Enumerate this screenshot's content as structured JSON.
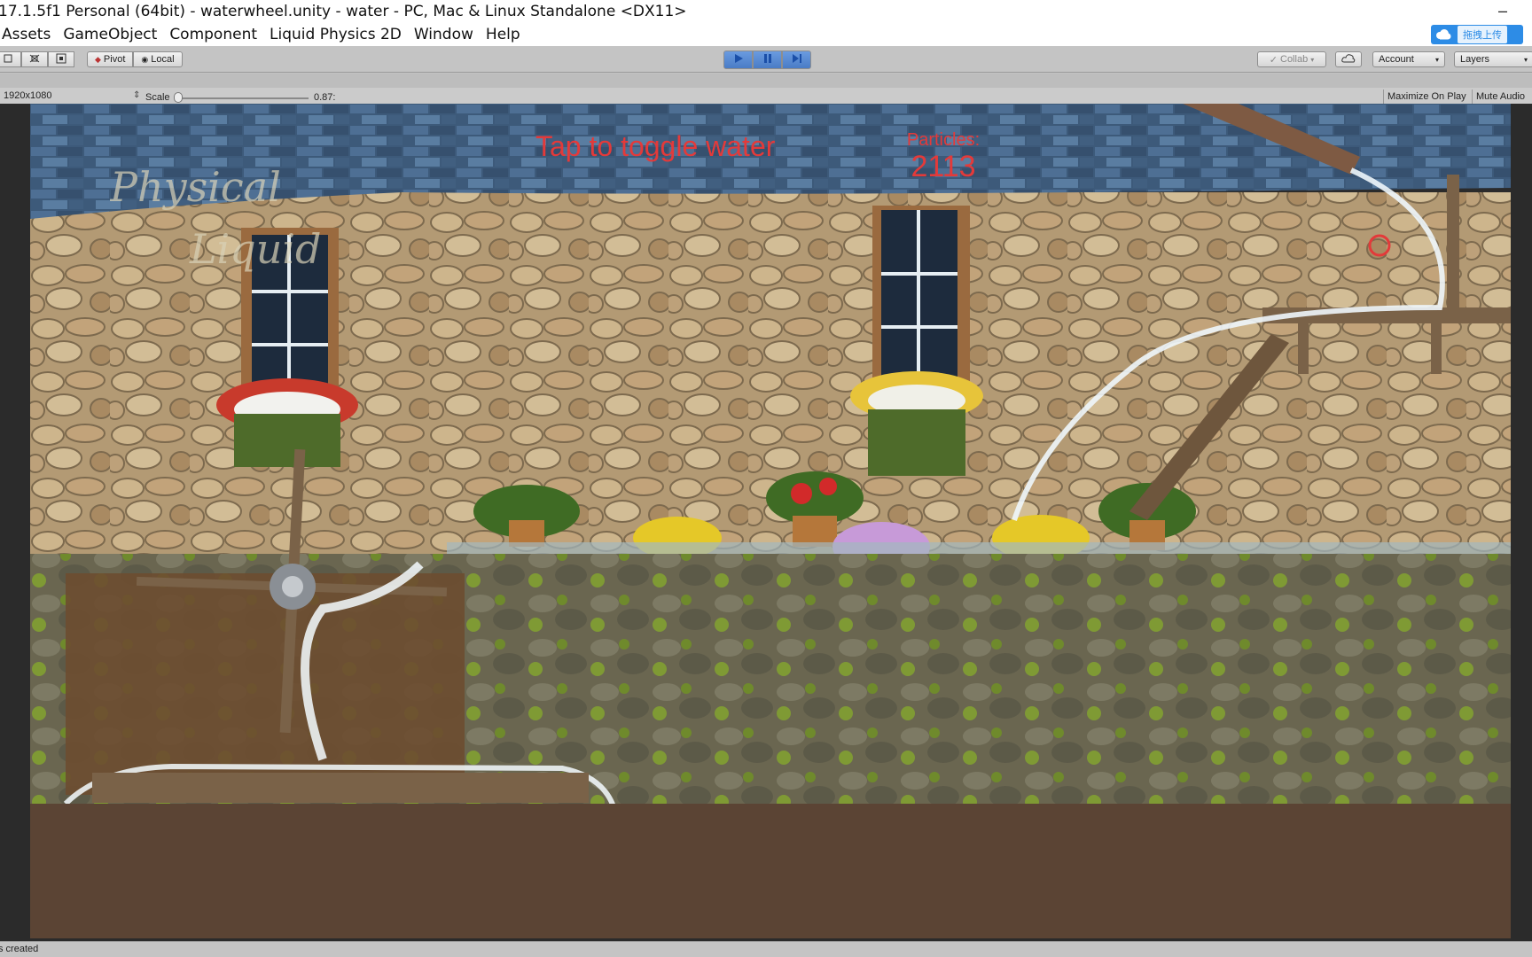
{
  "window": {
    "title": "17.1.5f1 Personal (64bit) - waterwheel.unity - water - PC, Mac & Linux Standalone <DX11>",
    "minimize_glyph": "–"
  },
  "menu": {
    "items": [
      "Assets",
      "GameObject",
      "Component",
      "Liquid Physics 2D",
      "Window",
      "Help"
    ],
    "upload_label": "拖拽上传"
  },
  "toolbar": {
    "pivot_label": "Pivot",
    "local_label": "Local",
    "collab_label": "Collab",
    "account_label": "Account",
    "layers_label": "Layers",
    "play_state": "playing",
    "accent_color": "#4a7cc6"
  },
  "game_view": {
    "resolution": "1920x1080",
    "scale_label": "Scale",
    "scale_value": "0.87:",
    "maximize_on_play": "Maximize On Play",
    "mute_audio": "Mute Audio"
  },
  "hud": {
    "tap_text": "Tap to toggle water",
    "particles_label": "Particles:",
    "particles_value": "2113",
    "text_color": "#e33a3a"
  },
  "logo": {
    "line1": "Physical",
    "line2": "Liquid"
  },
  "status": {
    "message": "s created"
  }
}
